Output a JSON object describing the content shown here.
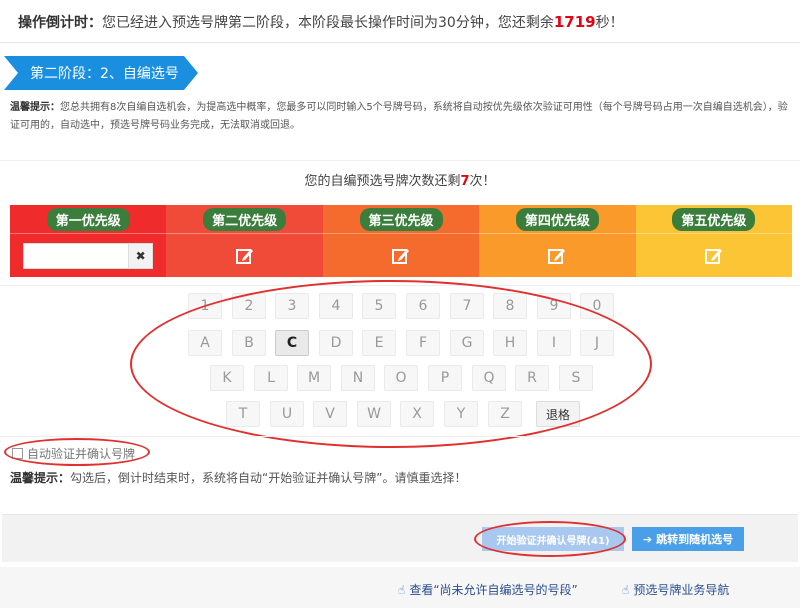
{
  "countdown": {
    "label": "操作倒计时：",
    "text_before": "您已经进入预选号牌第二阶段，本阶段最长操作时间为30分钟，您还剩余",
    "seconds": "1719",
    "text_after": "秒！"
  },
  "stage_banner": "第二阶段：2、自编选号",
  "tip1": {
    "label": "温馨提示：",
    "text": "您总共拥有8次自编自选机会，为提高选中概率，您最多可以同时输入5个号牌号码，系统将自动按优先级依次验证可用性（每个号牌号码占用一次自编自选机会），验证可用的，自动选中，预选号牌号码业务完成，无法取消或回退。"
  },
  "remaining": {
    "before": "您的自编预选号牌次数还剩",
    "count": "7",
    "after": "次！"
  },
  "priorities": [
    {
      "label": "第一优先级",
      "value": ""
    },
    {
      "label": "第二优先级"
    },
    {
      "label": "第三优先级"
    },
    {
      "label": "第四优先级"
    },
    {
      "label": "第五优先级"
    }
  ],
  "clear_label": "✖",
  "keyboard": {
    "row1": [
      "1",
      "2",
      "3",
      "4",
      "5",
      "6",
      "7",
      "8",
      "9",
      "0"
    ],
    "row2": [
      "A",
      "B",
      "C",
      "D",
      "E",
      "F",
      "G",
      "H",
      "I",
      "J"
    ],
    "row3": [
      "K",
      "L",
      "M",
      "N",
      "O",
      "P",
      "Q",
      "R",
      "S"
    ],
    "row4": [
      "T",
      "U",
      "V",
      "W",
      "X",
      "Y",
      "Z"
    ],
    "backspace": "退格",
    "active_key": "C"
  },
  "auto_verify_label": "自动验证并确认号牌",
  "tip2": {
    "label": "温馨提示：",
    "text": "勾选后，倒计时结束时，系统将自动“开始验证并确认号牌”。请慎重选择！"
  },
  "buttons": {
    "verify": "开始验证并确认号牌(41)",
    "random": "跳转到随机选号"
  },
  "links": {
    "view_segments": "查看“尚未允许自编选号的号段”",
    "guide": "预选号牌业务导航"
  },
  "colors": {
    "accent": "#1a8fe0",
    "alert": "#e60012",
    "priority_1": "#ef2b2b",
    "priority_2": "#f04a38",
    "priority_3": "#f56a2d",
    "priority_4": "#f99a2b",
    "priority_5": "#fcc535",
    "pill_green": "#3b7d3b",
    "annotation_red": "#e0302f"
  }
}
